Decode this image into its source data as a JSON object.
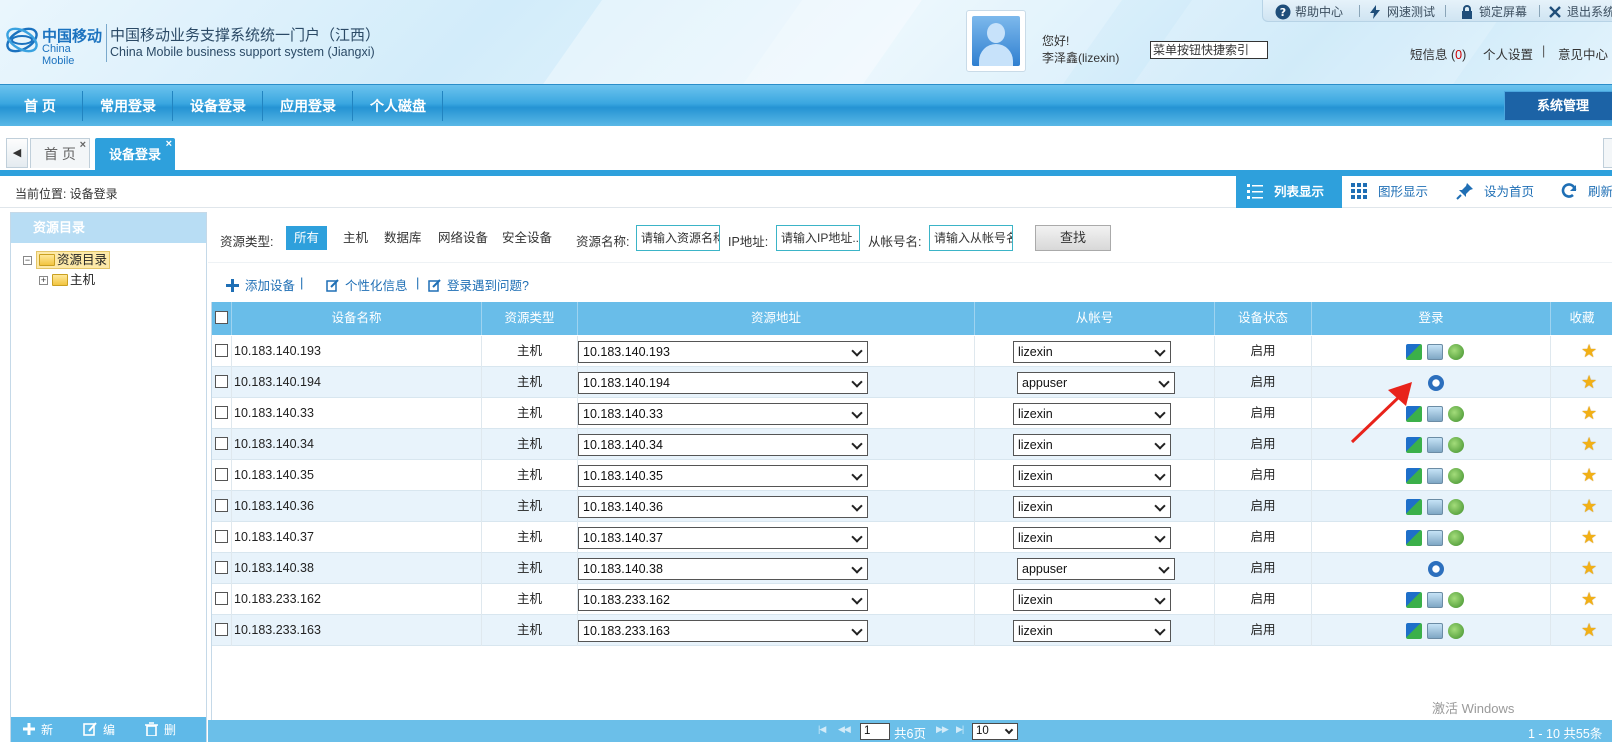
{
  "header": {
    "logo_cn": "中国移动",
    "logo_en": "China Mobile",
    "system_title_cn": "中国移动业务支撑系统统一门户（江西）",
    "system_title_en": "China Mobile business support system (Jiangxi)",
    "greeting": "您好!",
    "user": "李泽鑫(lizexin)",
    "quick_menu_value": "菜单按钮快捷索引",
    "top_links": {
      "help": "帮助中心",
      "speed_test": "网速测试",
      "lock": "锁定屏幕",
      "logout": "退出系统"
    },
    "message_label": "短信息 (",
    "message_count": "0",
    "message_close": ")",
    "personal_settings": "个人设置",
    "feedback": "意见中心",
    "link_separator": "|"
  },
  "nav": {
    "items": [
      "首 页",
      "常用登录",
      "设备登录",
      "应用登录",
      "个人磁盘"
    ],
    "system_manage": "系统管理"
  },
  "tabs": {
    "scroll_left": "◀",
    "home": "首 页",
    "active": "设备登录",
    "close": "×"
  },
  "location": {
    "label": "当前位置: 设备登录",
    "list_view": "列表显示",
    "graph_view": "图形显示",
    "set_home": "设为首页",
    "refresh": "刷新"
  },
  "tree": {
    "header": "资源目录",
    "root": "资源目录",
    "child": "主机",
    "root_toggle": "⊟",
    "child_toggle": "⊞",
    "footer": {
      "new": "新建",
      "edit": "编辑",
      "delete": "删除"
    }
  },
  "search": {
    "type_label": "资源类型:",
    "types": [
      "所有",
      "主机",
      "数据库",
      "网络设备",
      "安全设备"
    ],
    "active_type": "所有",
    "name_label": "资源名称:",
    "name_placeholder": "请输入资源名称",
    "ip_label": "IP地址:",
    "ip_placeholder": "请输入IP地址...",
    "account_label": "从帐号名:",
    "account_placeholder": "请输入从帐号名",
    "search_button": "查找"
  },
  "actions": {
    "add_device": "添加设备",
    "personalize": "个性化信息",
    "login_problem": "登录遇到问题?",
    "separator": "|"
  },
  "table": {
    "headers": [
      "设备名称",
      "资源类型",
      "资源地址",
      "从帐号",
      "设备状态",
      "登录",
      "收藏"
    ],
    "rows": [
      {
        "name": "10.183.140.193",
        "type": "主机",
        "address": "10.183.140.193",
        "account": "lizexin",
        "status": "启用",
        "login_icons": "full"
      },
      {
        "name": "10.183.140.194",
        "type": "主机",
        "address": "10.183.140.194",
        "account": "appuser",
        "status": "启用",
        "login_icons": "single"
      },
      {
        "name": "10.183.140.33",
        "type": "主机",
        "address": "10.183.140.33",
        "account": "lizexin",
        "status": "启用",
        "login_icons": "full"
      },
      {
        "name": "10.183.140.34",
        "type": "主机",
        "address": "10.183.140.34",
        "account": "lizexin",
        "status": "启用",
        "login_icons": "full"
      },
      {
        "name": "10.183.140.35",
        "type": "主机",
        "address": "10.183.140.35",
        "account": "lizexin",
        "status": "启用",
        "login_icons": "full"
      },
      {
        "name": "10.183.140.36",
        "type": "主机",
        "address": "10.183.140.36",
        "account": "lizexin",
        "status": "启用",
        "login_icons": "full"
      },
      {
        "name": "10.183.140.37",
        "type": "主机",
        "address": "10.183.140.37",
        "account": "lizexin",
        "status": "启用",
        "login_icons": "full"
      },
      {
        "name": "10.183.140.38",
        "type": "主机",
        "address": "10.183.140.38",
        "account": "appuser",
        "status": "启用",
        "login_icons": "single"
      },
      {
        "name": "10.183.233.162",
        "type": "主机",
        "address": "10.183.233.162",
        "account": "lizexin",
        "status": "启用",
        "login_icons": "full"
      },
      {
        "name": "10.183.233.163",
        "type": "主机",
        "address": "10.183.233.163",
        "account": "lizexin",
        "status": "启用",
        "login_icons": "full"
      }
    ]
  },
  "pager": {
    "page_value": "1",
    "total_pages": "共6页",
    "page_size": "10",
    "summary": "1 - 10  共55条"
  },
  "watermark": "激活 Windows",
  "colors": {
    "accent": "#2ea0dc",
    "header_blue": "#69bde9",
    "star": "#f2b015",
    "annotation_arrow": "#e8231b"
  }
}
